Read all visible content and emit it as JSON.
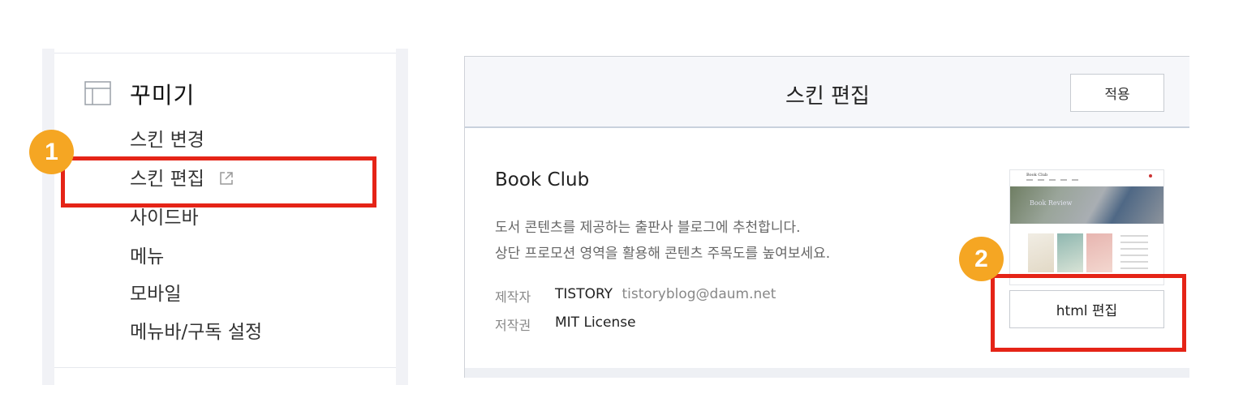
{
  "sidebar": {
    "section_title": "꾸미기",
    "section_icon": "layout-icon",
    "items": [
      {
        "label": "스킨 변경"
      },
      {
        "label": "스킨 편집",
        "icon": "external-link-icon"
      },
      {
        "label": "사이드바"
      },
      {
        "label": "메뉴"
      },
      {
        "label": "모바일"
      },
      {
        "label": "메뉴바/구독 설정"
      }
    ]
  },
  "editor": {
    "title": "스킨 편집",
    "apply_label": "적용",
    "skin": {
      "name": "Book Club",
      "description_lines": [
        "도서 콘텐츠를 제공하는 출판사 블로그에 추천합니다.",
        "상단 프로모션 영역을 활용해 콘텐츠 주목도를 높여보세요."
      ],
      "meta": {
        "author_label": "제작자",
        "author_name": "TISTORY",
        "author_email": "tistoryblog@daum.net",
        "license_label": "저작권",
        "license_value": "MIT License"
      },
      "thumbnail": {
        "logo_text": "Book Club",
        "hero_text": "Book Review"
      },
      "html_edit_label": "html 편집"
    }
  },
  "annotations": {
    "step1": "1",
    "step2": "2",
    "highlight_color": "#e52417",
    "badge_color": "#f5a623"
  }
}
